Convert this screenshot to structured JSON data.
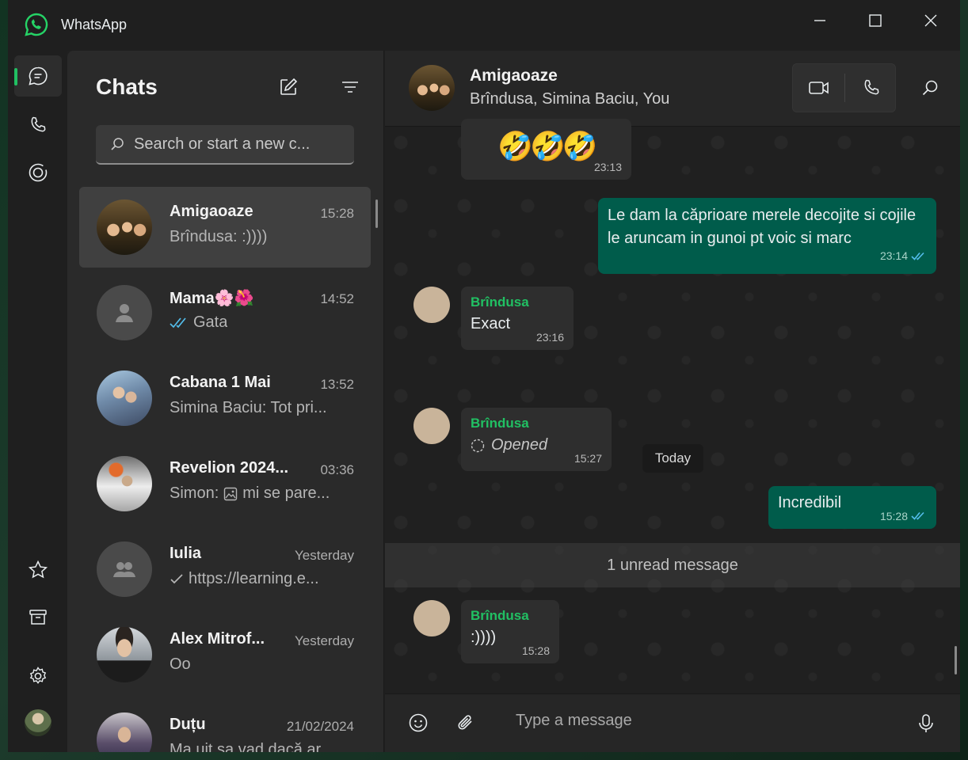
{
  "window": {
    "title": "WhatsApp"
  },
  "sidebar": {
    "title": "Chats",
    "search_placeholder": "Search or start a new c...",
    "chats": [
      {
        "name": "Amigaoaze",
        "time": "15:28",
        "preview": "Brîndusa: :))))",
        "selected": true
      },
      {
        "name": "Mama🌸🌺",
        "time": "14:52",
        "preview": "Gata",
        "status": "read-ticks"
      },
      {
        "name": "Cabana 1 Mai",
        "time": "13:52",
        "preview": "Simina Baciu: Tot pri..."
      },
      {
        "name": "Revelion 2024...",
        "time": "03:36",
        "preview_prefix": "Simon:",
        "preview": "mi se pare...",
        "icon": "image-icon"
      },
      {
        "name": "Iulia",
        "time": "Yesterday",
        "preview": "https://learning.e...",
        "status": "sent-tick"
      },
      {
        "name": "Alex Mitrof...",
        "time": "Yesterday",
        "preview": "Oo"
      },
      {
        "name": "Duțu",
        "time": "21/02/2024",
        "preview": "Ma uit sa vad dacă ar..."
      }
    ]
  },
  "conversation": {
    "name": "Amigaoaze",
    "members": "Brîndusa, Simina Baciu, You",
    "messages": [
      {
        "direction": "in",
        "text": "🤣🤣🤣",
        "time": "23:13"
      },
      {
        "direction": "out",
        "text": "Le dam la căprioare merele decojite si cojile le aruncam in gunoi pt voic si marc",
        "time": "23:14"
      },
      {
        "direction": "in",
        "sender": "Brîndusa",
        "text": "Exact",
        "time": "23:16"
      },
      {
        "direction": "in",
        "sender": "Brîndusa",
        "text": "Opened",
        "time": "15:27",
        "kind": "view-once"
      },
      {
        "direction": "out",
        "text": "Incredibil",
        "time": "15:28"
      },
      {
        "direction": "in",
        "sender": "Brîndusa",
        "text": ":))))",
        "time": "15:28"
      }
    ],
    "date_separator": "Today",
    "unread_banner": "1 unread message",
    "composer_placeholder": "Type a message"
  },
  "colors": {
    "accent": "#21c063",
    "outgoing_bubble": "#005c4b",
    "incoming_bubble": "#2e2e2e",
    "read_ticks": "#53bdeb"
  }
}
